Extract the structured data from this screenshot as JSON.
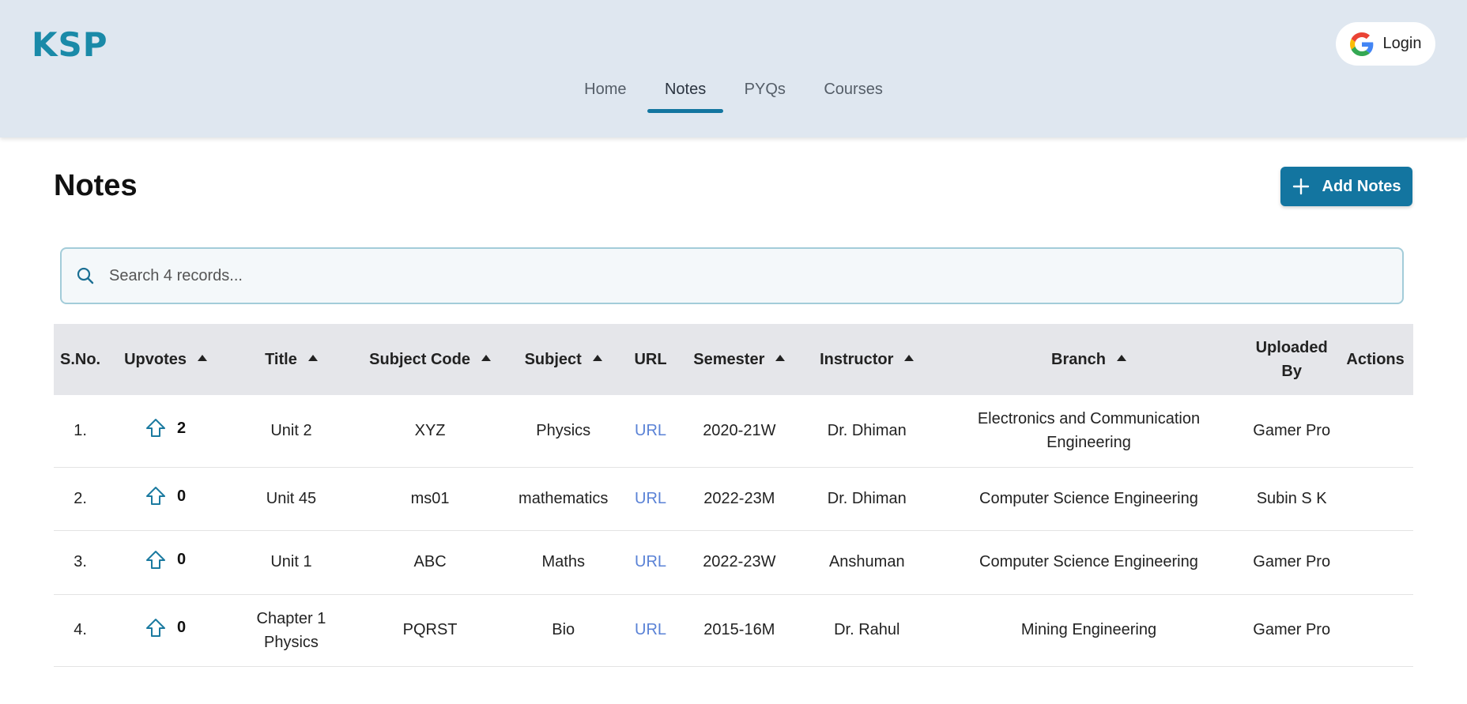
{
  "brand": {
    "logo": "KSP"
  },
  "nav": {
    "items": [
      {
        "label": "Home",
        "active": false
      },
      {
        "label": "Notes",
        "active": true
      },
      {
        "label": "PYQs",
        "active": false
      },
      {
        "label": "Courses",
        "active": false
      }
    ]
  },
  "login": {
    "label": "Login",
    "icon": "google-icon"
  },
  "page": {
    "title": "Notes",
    "add_button": "Add Notes",
    "add_icon": "plus-icon"
  },
  "search": {
    "placeholder": "Search 4 records...",
    "value": "",
    "icon": "search-icon"
  },
  "table": {
    "columns": [
      {
        "label": "S.No.",
        "sortable": false
      },
      {
        "label": "Upvotes",
        "sortable": true
      },
      {
        "label": "Title",
        "sortable": true
      },
      {
        "label": "Subject Code",
        "sortable": true
      },
      {
        "label": "Subject",
        "sortable": true
      },
      {
        "label": "URL",
        "sortable": false
      },
      {
        "label": "Semester",
        "sortable": true
      },
      {
        "label": "Instructor",
        "sortable": true
      },
      {
        "label": "Branch",
        "sortable": true
      },
      {
        "label": "Uploaded By",
        "sortable": false
      },
      {
        "label": "Actions",
        "sortable": false
      }
    ],
    "rows": [
      {
        "sno": "1.",
        "upvotes": "2",
        "title": "Unit 2",
        "subject_code": "XYZ",
        "subject": "Physics",
        "url": "URL",
        "semester": "2020-21W",
        "instructor": "Dr. Dhiman",
        "branch": "Electronics and Communication Engineering",
        "uploaded_by": "Gamer Pro"
      },
      {
        "sno": "2.",
        "upvotes": "0",
        "title": "Unit 45",
        "subject_code": "ms01",
        "subject": "mathematics",
        "url": "URL",
        "semester": "2022-23M",
        "instructor": "Dr. Dhiman",
        "branch": "Computer Science Engineering",
        "uploaded_by": "Subin S K"
      },
      {
        "sno": "3.",
        "upvotes": "0",
        "title": "Unit 1",
        "subject_code": "ABC",
        "subject": "Maths",
        "url": "URL",
        "semester": "2022-23W",
        "instructor": "Anshuman",
        "branch": "Computer Science Engineering",
        "uploaded_by": "Gamer Pro"
      },
      {
        "sno": "4.",
        "upvotes": "0",
        "title": "Chapter 1 Physics",
        "subject_code": "PQRST",
        "subject": "Bio",
        "url": "URL",
        "semester": "2015-16M",
        "instructor": "Dr. Rahul",
        "branch": "Mining Engineering",
        "uploaded_by": "Gamer Pro"
      }
    ]
  },
  "colors": {
    "accent": "#1375a0",
    "header_bg": "#dfe7f0",
    "link": "#5a82d6",
    "table_header_bg": "#e5e6ea"
  }
}
